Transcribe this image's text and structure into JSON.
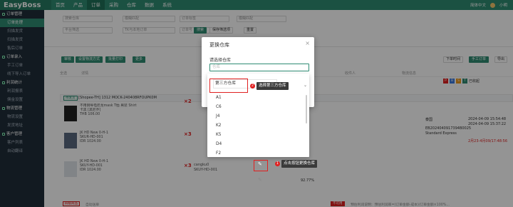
{
  "app": {
    "logo": "EasyBoss"
  },
  "nav": [
    "首页",
    "产品",
    "订单",
    "采购",
    "仓库",
    "数据",
    "系统"
  ],
  "topright": {
    "lang": "简体中文",
    "user": "小明"
  },
  "sidebar": {
    "groups": [
      {
        "label": "订单管理",
        "items": [
          "订单处理",
          "扫描发货",
          "扫描发货",
          "售后订单"
        ]
      },
      {
        "label": "订单录入",
        "items": [
          "手工订单",
          "线下导入订单"
        ]
      },
      {
        "label": "利润统计",
        "items": [
          "利润报表",
          "佣金设置"
        ]
      },
      {
        "label": "物流管理",
        "items": [
          "物流设置",
          "发货地址"
        ]
      },
      {
        "label": "客户管理",
        "items": [
          "客户列表",
          "自动翻译"
        ]
      }
    ]
  },
  "filter": {
    "r1": [
      "搜索仓库",
      "模糊匹配",
      "订单标签",
      "模糊匹配"
    ],
    "r2": [
      "平台筛选",
      "TK与本地订单",
      "订单号",
      "模糊匹配"
    ],
    "search_btn": "搜索",
    "save_btn": "保存筛选项",
    "reset_btn": "重置"
  },
  "toolbar": {
    "b1": "审核",
    "b2": "设置物流方式",
    "b3": "批量打印",
    "b4": "更多",
    "right1": "下单时间",
    "right2": "手工订单",
    "right3": "导出",
    "tab1": "已收起",
    "tab2": "展开"
  },
  "table": {
    "sel": "全选",
    "col": "详情",
    "more": "更多",
    "h_recv": "收件人",
    "h_log": "物流信息",
    "h_op": "操作"
  },
  "order": {
    "platform": "待发货",
    "shop": "[Shopee-TH] 1312",
    "no": "MOCK-240408RFOUPK0M",
    "country": "泰国",
    "time1": "2024-04-09 15:54:48",
    "time2": "2024-04-09 15:37:22",
    "track": "EB2024040917394B0025",
    "carrier": "Standard Express",
    "ship_deadline": "2月23-4月09/17:48:56"
  },
  "products": [
    {
      "name": "不用倒导电尼龙mask T恤 男装 Shirt",
      "sku": "卡黑 [黑尼乔]",
      "price": "THB 106.00",
      "qty": "×2"
    },
    {
      "name": "JK HD New 0-H-1",
      "sku": "SKUR-HD-001",
      "price": "IDR 1024.00",
      "qty": "×3"
    },
    {
      "name": "JK HD New 0-H-1",
      "sku": "SKUY-HD-001",
      "price": "IDR 1024.00",
      "qty": "×3"
    }
  ],
  "product3_wh": "cangku0",
  "product3_sku": "SKUY-HD-001",
  "profit": "92.77%",
  "bottom": {
    "warn": "四级商品",
    "hint": "自动送单",
    "notice": "预估利润说明：预估利润率=(订单金额-成本)/订单金额×100%...",
    "btn": "不可用"
  },
  "modal": {
    "title": "更换仓库",
    "label": "请选择仓库",
    "placeholder": "仓库",
    "selected": "第三方仓库",
    "options": [
      "A1",
      "C6",
      "J4",
      "K2",
      "K5",
      "D4",
      "F2"
    ]
  },
  "annotations": {
    "step2": "2",
    "tip2": "选择第三方仓库",
    "step1": "1",
    "tip1": "点击按钮更换仓库"
  },
  "colors": {
    "brand": "#2f8c73",
    "highlight": "#e02020"
  }
}
